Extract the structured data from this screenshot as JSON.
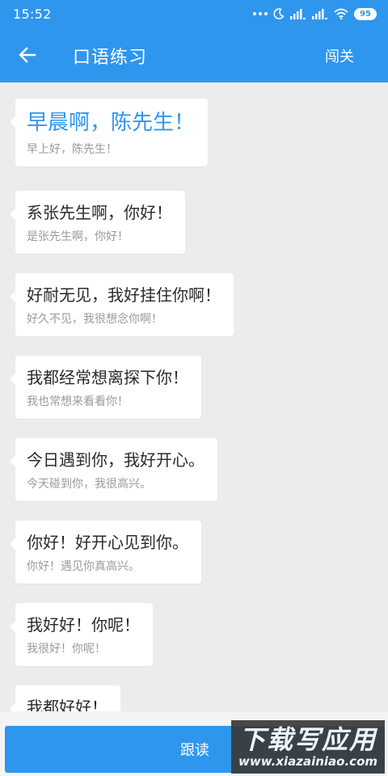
{
  "status_bar": {
    "time": "15:52",
    "battery": "95",
    "icons": [
      "more-dots-icon",
      "moon-icon",
      "signal-icon",
      "signal-icon",
      "wifi-icon",
      "battery-icon"
    ]
  },
  "header": {
    "title": "口语练习",
    "back_icon": "arrow-left-icon",
    "action_label": "闯关"
  },
  "colors": {
    "primary": "#2f96ee",
    "background": "#ececec",
    "bubble": "#ffffff",
    "text": "#2a2a2a",
    "subtext": "#9a9a9a"
  },
  "messages": [
    {
      "main": "早晨啊，陈先生！",
      "sub": "早上好，陈先生！",
      "active": true
    },
    {
      "main": "系张先生啊，你好！",
      "sub": "是张先生啊，你好！"
    },
    {
      "main": "好耐无见，我好挂住你啊！",
      "sub": "好久不见，我很想念你啊！"
    },
    {
      "main": "我都经常想离探下你！",
      "sub": "我也常想来看看你！"
    },
    {
      "main": "今日遇到你，我好开心。",
      "sub": "今天碰到你，我很高兴。"
    },
    {
      "main": "你好！好开心见到你。",
      "sub": "你好！遇见你真高兴。"
    },
    {
      "main": "我好好！你呢！",
      "sub": "我很好！你呢！"
    },
    {
      "main": "我都好好！",
      "sub": ""
    }
  ],
  "bottom": {
    "read_label": "跟读"
  },
  "watermark": {
    "title": "下载写应用",
    "url": "www.xiazainiao.com"
  }
}
